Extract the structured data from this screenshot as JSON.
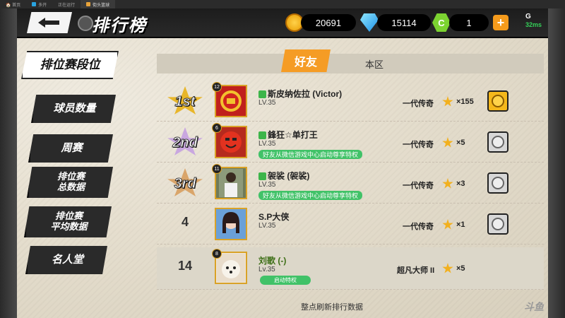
{
  "window": {
    "tabs": [
      {
        "label": "🏠 首页"
      },
      {
        "label": "多开"
      },
      {
        "label": "正在运行"
      },
      {
        "label": "街头篮球"
      }
    ]
  },
  "header": {
    "title": "排行榜",
    "coins": "20691",
    "diamonds": "15114",
    "c_icon": "C",
    "c_value": "1",
    "plus": "+",
    "signal": "G",
    "ping": "32ms"
  },
  "side_menu": [
    {
      "label": "排位赛段位",
      "active": true
    },
    {
      "label": "球员数量"
    },
    {
      "label": "周赛"
    },
    {
      "label": "排位赛\n总数据"
    },
    {
      "label": "排位赛\n平均数据"
    },
    {
      "label": "名人堂"
    }
  ],
  "tabs": {
    "friends": "好友",
    "server": "本区"
  },
  "rows": [
    {
      "rank": "1st",
      "level_chip": "12",
      "name": "斯皮纳佐拉 (Victor)",
      "lv": "LV.35",
      "wx_tag": "",
      "title": "一代传奇",
      "stars": "×155",
      "action": "gold"
    },
    {
      "rank": "2nd",
      "level_chip": "6",
      "name": "鋒狂☆单打王",
      "lv": "LV.35",
      "wx_tag": "好友从微信游戏中心启动尊享特权",
      "title": "一代传奇",
      "stars": "×5",
      "action": "grey"
    },
    {
      "rank": "3rd",
      "level_chip": "11",
      "name": "袈裟 (袈裟)",
      "lv": "LV.35",
      "wx_tag": "好友从微信游戏中心启动尊享特权",
      "title": "一代传奇",
      "stars": "×3",
      "action": "grey"
    },
    {
      "rank": "4",
      "level_chip": "",
      "name": "S.P大侠",
      "lv": "LV.35",
      "wx_tag": "",
      "title": "一代传奇",
      "stars": "×1",
      "action": "grey"
    },
    {
      "rank": "14",
      "level_chip": "8",
      "name": "刘歌 (-)",
      "lv": "Lv.35",
      "wx_tag": "启动特权",
      "title": "超凡大师 II",
      "stars": "×5",
      "action": ""
    }
  ],
  "footer": {
    "refresh": "整点刷新排行数据",
    "watermark": "斗鱼"
  },
  "colors": {
    "accent_orange": "#f59c25",
    "wechat_green": "#41c268",
    "gold": "#f2b01e"
  }
}
